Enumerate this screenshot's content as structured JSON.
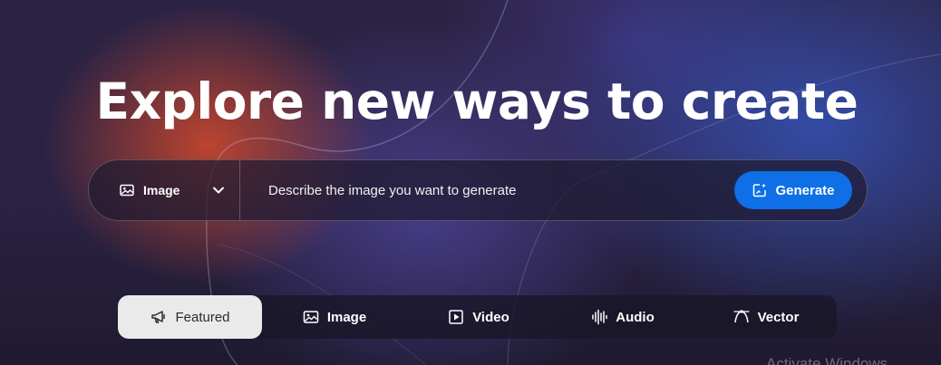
{
  "hero": {
    "headline": "Explore new ways to create"
  },
  "prompt_bar": {
    "type_select": {
      "label": "Image",
      "icon": "image-icon",
      "chevron": "chevron-down-icon"
    },
    "input": {
      "placeholder": "Describe the image you want to generate",
      "value": ""
    },
    "generate_button": {
      "label": "Generate",
      "icon": "generate-sparkle-icon",
      "color": "#0e6fe6"
    }
  },
  "tabs": [
    {
      "label": "Featured",
      "icon": "megaphone-icon",
      "active": true
    },
    {
      "label": "Image",
      "icon": "image-icon",
      "active": false
    },
    {
      "label": "Video",
      "icon": "play-icon",
      "active": false
    },
    {
      "label": "Audio",
      "icon": "audio-waveform-icon",
      "active": false
    },
    {
      "label": "Vector",
      "icon": "vector-pen-icon",
      "active": false
    }
  ],
  "watermark": {
    "text": "Activate Windows"
  }
}
